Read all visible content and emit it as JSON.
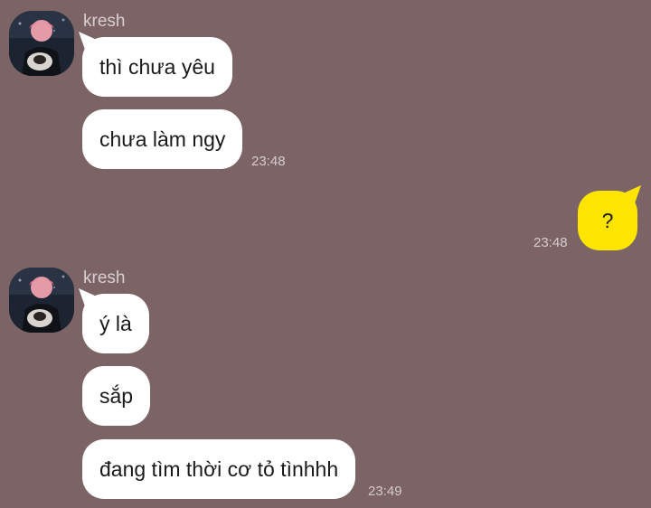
{
  "chat": {
    "groups": [
      {
        "sender": "kresh",
        "messages": [
          "thì chưa yêu",
          "chưa làm ngy"
        ],
        "time": "23:48"
      },
      {
        "sender": "me",
        "messages": [
          "?"
        ],
        "time": "23:48"
      },
      {
        "sender": "kresh",
        "messages": [
          "ý là",
          "sắp",
          "đang tìm thời cơ tỏ tìnhhh"
        ],
        "time": "23:49"
      }
    ]
  },
  "colors": {
    "background": "#7b6366",
    "incoming_bubble": "#ffffff",
    "outgoing_bubble": "#fee500"
  },
  "icons": {
    "avatar": "profile-photo"
  }
}
